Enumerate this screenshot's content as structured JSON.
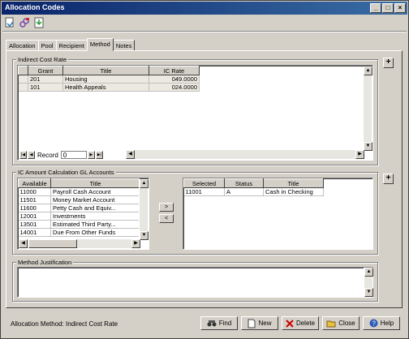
{
  "window": {
    "title": "Allocation Codes",
    "min": "_",
    "max": "□",
    "close": "×"
  },
  "tabs": [
    "Allocation",
    "Pool",
    "Recipient",
    "Method",
    "Notes"
  ],
  "indirect": {
    "legend": "Indirect Cost Rate",
    "headers": [
      "Grant",
      "Title",
      "IC Rate"
    ],
    "rows": [
      [
        "201",
        "Housing",
        "049.0000"
      ],
      [
        "101",
        "Health Appeals",
        "024.0000"
      ]
    ],
    "record_label": "Record",
    "record_value": "0"
  },
  "ic": {
    "legend": "IC Amount Calculation GL Accounts",
    "avail_headers": [
      "Available",
      "Title"
    ],
    "avail_rows": [
      [
        "11000",
        "Payroll Cash Account"
      ],
      [
        "11501",
        "Money Market Account"
      ],
      [
        "11600",
        "Petty Cash and Equiv..."
      ],
      [
        "12001",
        "Investments"
      ],
      [
        "13501",
        "Estimated Third Party..."
      ],
      [
        "14001",
        "Due From Other Funds"
      ]
    ],
    "sel_headers": [
      "Selected",
      "Status",
      "Title"
    ],
    "sel_rows": [
      [
        "11001",
        "A",
        "Cash in Checking"
      ]
    ],
    "move_right": ">",
    "move_left": "<"
  },
  "justification": {
    "legend": "Method Justification",
    "value": ""
  },
  "status": "Allocation Method: Indirect Cost Rate",
  "buttons": {
    "find": "Find",
    "new": "New",
    "delete": "Delete",
    "close": "Close",
    "help": "Help"
  },
  "plus": "+",
  "colors": {
    "title_start": "#0a246a",
    "title_end": "#3a6ea5",
    "face": "#d4d0c8"
  }
}
